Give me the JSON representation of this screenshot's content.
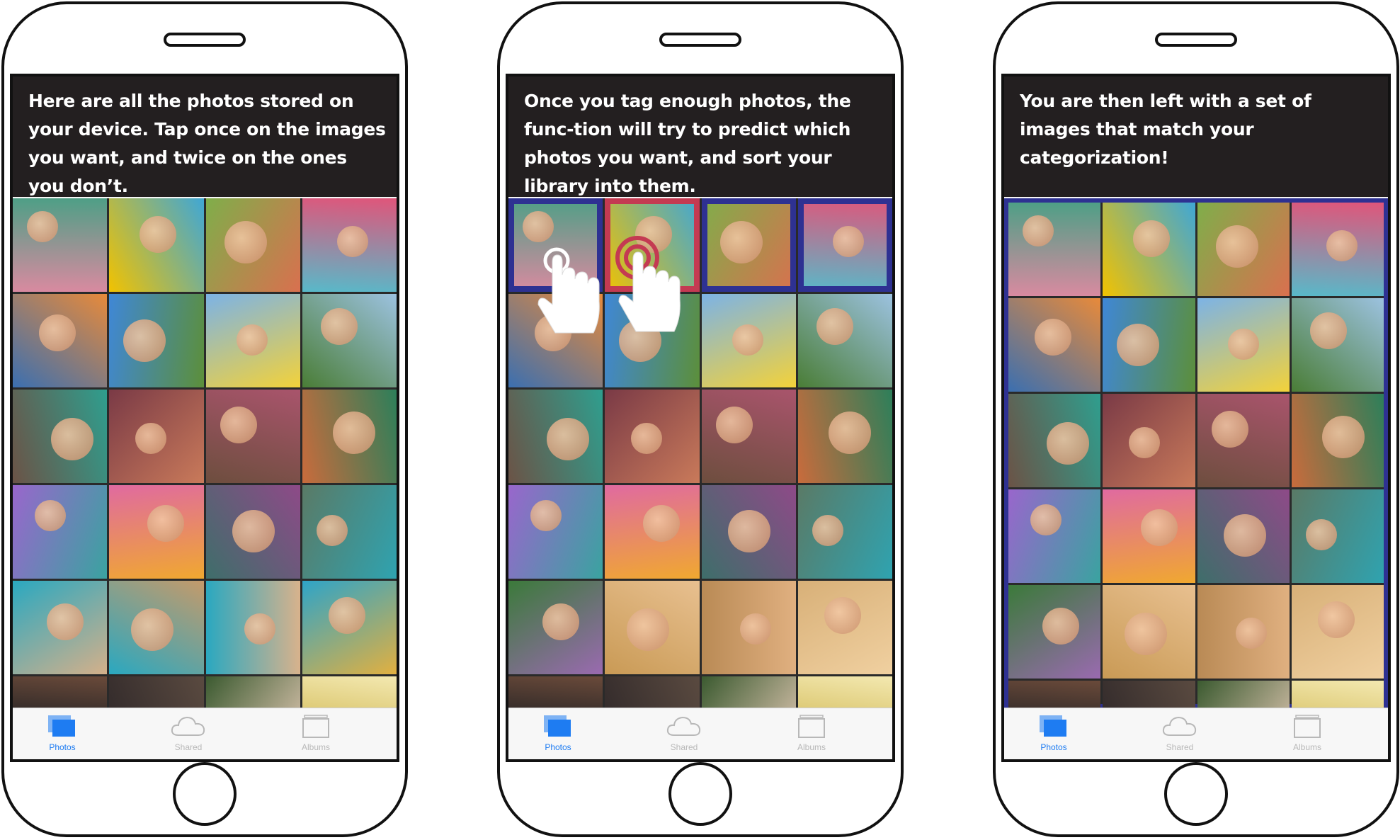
{
  "phones": [
    {
      "instruction": "Here are all the photos stored on your device. Tap once on the images you want, and twice on the ones you don’t.",
      "tabs": [
        {
          "label": "Photos",
          "icon": "photos-icon"
        },
        {
          "label": "Shared",
          "icon": "cloud-icon"
        },
        {
          "label": "Albums",
          "icon": "albums-icon"
        }
      ],
      "active_tab": "Photos"
    },
    {
      "instruction": "Once you tag enough photos, the func-tion will try to predict which photos you want, and sort your library into them.",
      "tabs": [
        {
          "label": "Photos",
          "icon": "photos-icon"
        },
        {
          "label": "Shared",
          "icon": "cloud-icon"
        },
        {
          "label": "Albums",
          "icon": "albums-icon"
        }
      ],
      "active_tab": "Photos"
    },
    {
      "instruction": "You are then left with a set of images that match your categorization!",
      "tabs": [
        {
          "label": "Photos",
          "icon": "photos-icon"
        },
        {
          "label": "Shared",
          "icon": "cloud-icon"
        },
        {
          "label": "Albums",
          "icon": "albums-icon"
        }
      ],
      "active_tab": "Photos"
    }
  ],
  "colors": {
    "banner_bg": "#231f20",
    "tag_want": "#2e3192",
    "tag_reject": "#c43a52",
    "tab_active": "#1e7cf2",
    "tab_inactive": "#b8b8b8"
  }
}
